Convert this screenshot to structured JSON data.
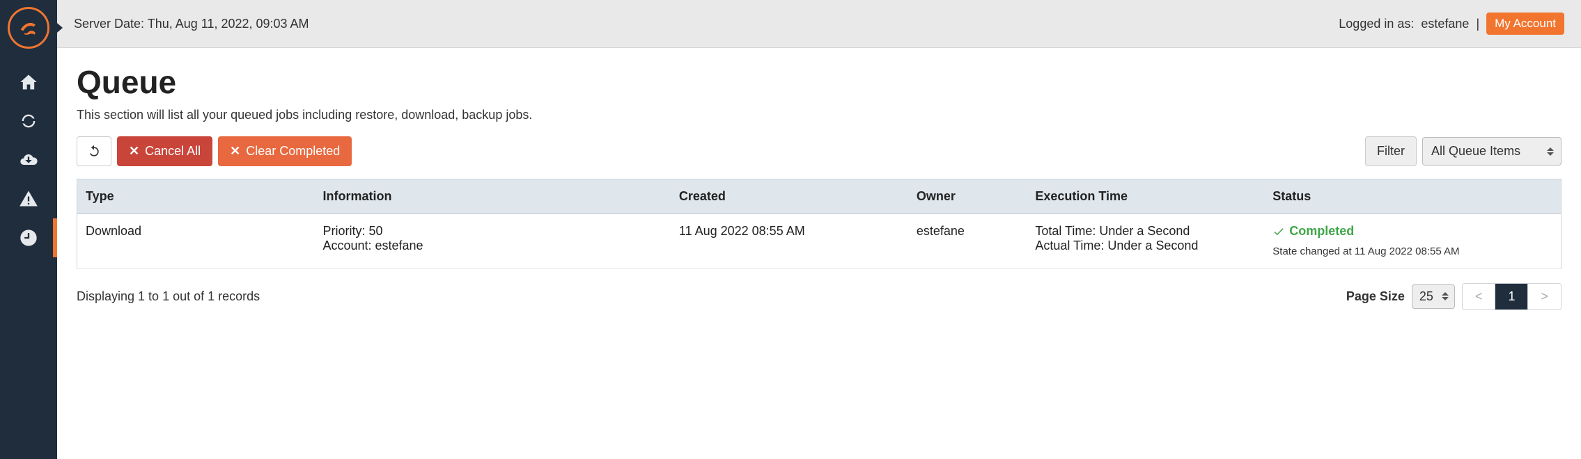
{
  "colors": {
    "accent": "#f1752f",
    "danger": "#c9453a",
    "success": "#3fa648",
    "sidebar_bg": "#1f2d3d"
  },
  "topbar": {
    "server_date": "Server Date: Thu, Aug 11, 2022, 09:03 AM",
    "logged_in_label": "Logged in as:",
    "username": "estefane",
    "separator": "|",
    "my_account_label": "My Account"
  },
  "page": {
    "title": "Queue",
    "subtitle": "This section will list all your queued jobs including restore, download, backup jobs."
  },
  "toolbar": {
    "cancel_all_label": "Cancel All",
    "clear_completed_label": "Clear Completed",
    "filter_label": "Filter",
    "filter_select_value": "All Queue Items"
  },
  "table": {
    "headers": {
      "type": "Type",
      "information": "Information",
      "created": "Created",
      "owner": "Owner",
      "execution_time": "Execution Time",
      "status": "Status"
    },
    "rows": [
      {
        "type": "Download",
        "info_line1": "Priority: 50",
        "info_line2": "Account: estefane",
        "created": "11 Aug 2022 08:55 AM",
        "owner": "estefane",
        "exec_line1": "Total Time: Under a Second",
        "exec_line2": "Actual Time: Under a Second",
        "status_label": "Completed",
        "status_sub": "State changed at 11 Aug 2022 08:55 AM"
      }
    ]
  },
  "footer": {
    "summary": "Displaying 1 to 1 out of 1 records",
    "page_size_label": "Page Size",
    "page_size_value": "25",
    "pager": {
      "prev": "<",
      "current": "1",
      "next": ">"
    }
  },
  "sidebar": {
    "items": [
      {
        "name": "home-icon"
      },
      {
        "name": "refresh-icon"
      },
      {
        "name": "cloud-download-icon"
      },
      {
        "name": "alert-icon"
      },
      {
        "name": "clock-icon"
      }
    ]
  }
}
